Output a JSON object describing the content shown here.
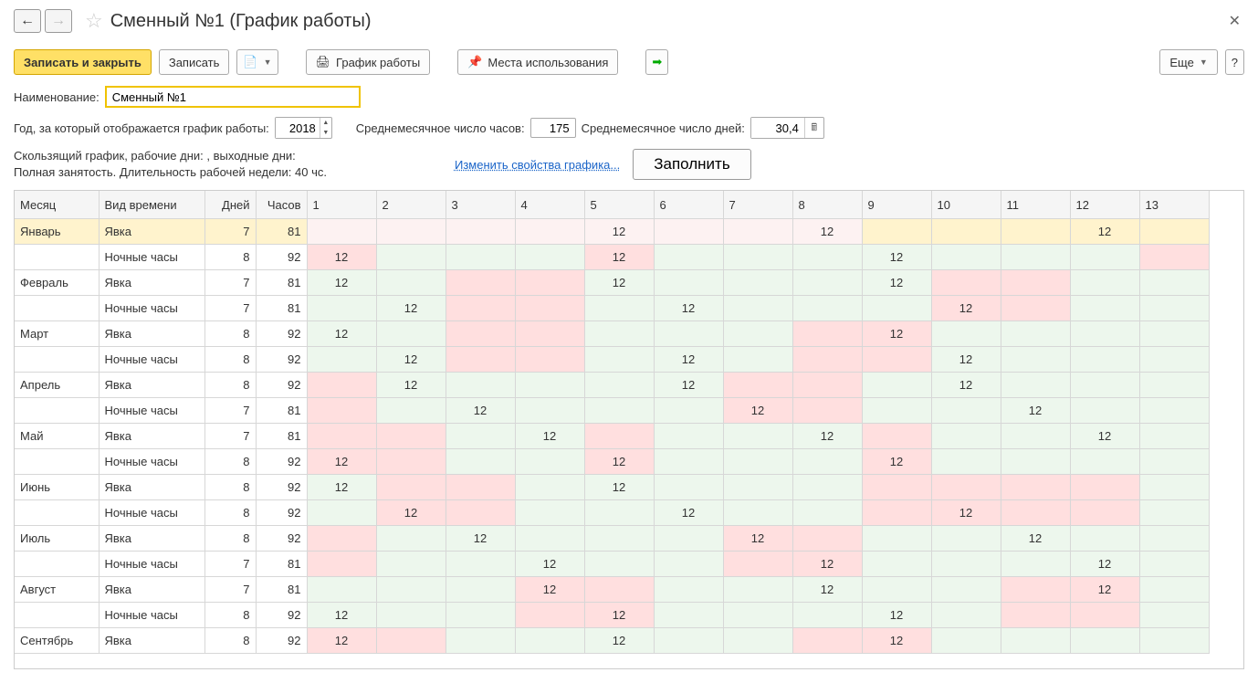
{
  "title": "Сменный №1 (График работы)",
  "toolbar": {
    "save_close": "Записать и закрыть",
    "save": "Записать",
    "print_schedule": "График работы",
    "usage_places": "Места использования",
    "more": "Еще",
    "help": "?"
  },
  "fields": {
    "name_label": "Наименование:",
    "name_value": "Сменный №1",
    "year_label": "Год, за который отображается график работы:",
    "year_value": "2018",
    "avg_hours_label": "Среднемесячное число часов:",
    "avg_hours_value": "175",
    "avg_days_label": "Среднемесячное число дней:",
    "avg_days_value": "30,4"
  },
  "info": {
    "line1": "Скользящий график, рабочие дни: , выходные дни:",
    "line2": "Полная занятость. Длительность рабочей недели: 40 чс.",
    "edit_link": "Изменить свойства графика...",
    "fill_button": "Заполнить"
  },
  "table": {
    "headers": {
      "month": "Месяц",
      "type": "Вид времени",
      "days": "Дней",
      "hours": "Часов"
    },
    "day_count": 13,
    "rows": [
      {
        "month": "Январь",
        "type": "Явка",
        "days": "7",
        "hours": "81",
        "first": true,
        "cells": [
          {
            "c": "blush"
          },
          {
            "c": "blush"
          },
          {
            "c": "blush"
          },
          {
            "c": "blush"
          },
          {
            "c": "blush",
            "v": "12"
          },
          {
            "c": "blush"
          },
          {
            "c": "blush"
          },
          {
            "c": "blush",
            "v": "12"
          },
          {
            "c": "yellow"
          },
          {
            "c": "yellow"
          },
          {
            "c": "yellow"
          },
          {
            "c": "yellow",
            "v": "12"
          },
          {
            "c": "yellow"
          }
        ]
      },
      {
        "month": "",
        "type": "Ночные часы",
        "days": "8",
        "hours": "92",
        "cells": [
          {
            "c": "pink",
            "v": "12"
          },
          {
            "c": "green"
          },
          {
            "c": "green"
          },
          {
            "c": "green"
          },
          {
            "c": "pink",
            "v": "12"
          },
          {
            "c": "green"
          },
          {
            "c": "green"
          },
          {
            "c": "green"
          },
          {
            "c": "green",
            "v": "12"
          },
          {
            "c": "green"
          },
          {
            "c": "green"
          },
          {
            "c": "green"
          },
          {
            "c": "pink"
          }
        ]
      },
      {
        "month": "Февраль",
        "type": "Явка",
        "days": "7",
        "hours": "81",
        "cells": [
          {
            "c": "green",
            "v": "12"
          },
          {
            "c": "green"
          },
          {
            "c": "pink"
          },
          {
            "c": "pink"
          },
          {
            "c": "green",
            "v": "12"
          },
          {
            "c": "green"
          },
          {
            "c": "green"
          },
          {
            "c": "green"
          },
          {
            "c": "green",
            "v": "12"
          },
          {
            "c": "pink"
          },
          {
            "c": "pink"
          },
          {
            "c": "green"
          },
          {
            "c": "green"
          }
        ]
      },
      {
        "month": "",
        "type": "Ночные часы",
        "days": "7",
        "hours": "81",
        "cells": [
          {
            "c": "green"
          },
          {
            "c": "green",
            "v": "12"
          },
          {
            "c": "pink"
          },
          {
            "c": "pink"
          },
          {
            "c": "green"
          },
          {
            "c": "green",
            "v": "12"
          },
          {
            "c": "green"
          },
          {
            "c": "green"
          },
          {
            "c": "green"
          },
          {
            "c": "pink",
            "v": "12"
          },
          {
            "c": "pink"
          },
          {
            "c": "green"
          },
          {
            "c": "green"
          }
        ]
      },
      {
        "month": "Март",
        "type": "Явка",
        "days": "8",
        "hours": "92",
        "cells": [
          {
            "c": "green",
            "v": "12"
          },
          {
            "c": "green"
          },
          {
            "c": "pink"
          },
          {
            "c": "pink"
          },
          {
            "c": "green"
          },
          {
            "c": "green"
          },
          {
            "c": "green"
          },
          {
            "c": "pink"
          },
          {
            "c": "pink",
            "v": "12"
          },
          {
            "c": "green"
          },
          {
            "c": "green"
          },
          {
            "c": "green"
          },
          {
            "c": "green"
          }
        ]
      },
      {
        "month": "",
        "type": "Ночные часы",
        "days": "8",
        "hours": "92",
        "cells": [
          {
            "c": "green"
          },
          {
            "c": "green",
            "v": "12"
          },
          {
            "c": "pink"
          },
          {
            "c": "pink"
          },
          {
            "c": "green"
          },
          {
            "c": "green",
            "v": "12"
          },
          {
            "c": "green"
          },
          {
            "c": "pink"
          },
          {
            "c": "pink"
          },
          {
            "c": "green",
            "v": "12"
          },
          {
            "c": "green"
          },
          {
            "c": "green"
          },
          {
            "c": "green"
          }
        ]
      },
      {
        "month": "Апрель",
        "type": "Явка",
        "days": "8",
        "hours": "92",
        "cells": [
          {
            "c": "pink"
          },
          {
            "c": "green",
            "v": "12"
          },
          {
            "c": "green"
          },
          {
            "c": "green"
          },
          {
            "c": "green"
          },
          {
            "c": "green",
            "v": "12"
          },
          {
            "c": "pink"
          },
          {
            "c": "pink"
          },
          {
            "c": "green"
          },
          {
            "c": "green",
            "v": "12"
          },
          {
            "c": "green"
          },
          {
            "c": "green"
          },
          {
            "c": "green"
          }
        ]
      },
      {
        "month": "",
        "type": "Ночные часы",
        "days": "7",
        "hours": "81",
        "cells": [
          {
            "c": "pink"
          },
          {
            "c": "green"
          },
          {
            "c": "green",
            "v": "12"
          },
          {
            "c": "green"
          },
          {
            "c": "green"
          },
          {
            "c": "green"
          },
          {
            "c": "pink",
            "v": "12"
          },
          {
            "c": "pink"
          },
          {
            "c": "green"
          },
          {
            "c": "green"
          },
          {
            "c": "green",
            "v": "12"
          },
          {
            "c": "green"
          },
          {
            "c": "green"
          }
        ]
      },
      {
        "month": "Май",
        "type": "Явка",
        "days": "7",
        "hours": "81",
        "cells": [
          {
            "c": "pink"
          },
          {
            "c": "pink"
          },
          {
            "c": "green"
          },
          {
            "c": "green",
            "v": "12"
          },
          {
            "c": "pink"
          },
          {
            "c": "green"
          },
          {
            "c": "green"
          },
          {
            "c": "green",
            "v": "12"
          },
          {
            "c": "pink"
          },
          {
            "c": "green"
          },
          {
            "c": "green"
          },
          {
            "c": "green",
            "v": "12"
          },
          {
            "c": "green"
          }
        ]
      },
      {
        "month": "",
        "type": "Ночные часы",
        "days": "8",
        "hours": "92",
        "cells": [
          {
            "c": "pink",
            "v": "12"
          },
          {
            "c": "pink"
          },
          {
            "c": "green"
          },
          {
            "c": "green"
          },
          {
            "c": "pink",
            "v": "12"
          },
          {
            "c": "green"
          },
          {
            "c": "green"
          },
          {
            "c": "green"
          },
          {
            "c": "pink",
            "v": "12"
          },
          {
            "c": "green"
          },
          {
            "c": "green"
          },
          {
            "c": "green"
          },
          {
            "c": "green"
          }
        ]
      },
      {
        "month": "Июнь",
        "type": "Явка",
        "days": "8",
        "hours": "92",
        "cells": [
          {
            "c": "green",
            "v": "12"
          },
          {
            "c": "pink"
          },
          {
            "c": "pink"
          },
          {
            "c": "green"
          },
          {
            "c": "green",
            "v": "12"
          },
          {
            "c": "green"
          },
          {
            "c": "green"
          },
          {
            "c": "green"
          },
          {
            "c": "pink"
          },
          {
            "c": "pink"
          },
          {
            "c": "pink"
          },
          {
            "c": "pink"
          },
          {
            "c": "green"
          }
        ]
      },
      {
        "month": "",
        "type": "Ночные часы",
        "days": "8",
        "hours": "92",
        "cells": [
          {
            "c": "green"
          },
          {
            "c": "pink",
            "v": "12"
          },
          {
            "c": "pink"
          },
          {
            "c": "green"
          },
          {
            "c": "green"
          },
          {
            "c": "green",
            "v": "12"
          },
          {
            "c": "green"
          },
          {
            "c": "green"
          },
          {
            "c": "pink"
          },
          {
            "c": "pink",
            "v": "12"
          },
          {
            "c": "pink"
          },
          {
            "c": "pink"
          },
          {
            "c": "green"
          }
        ]
      },
      {
        "month": "Июль",
        "type": "Явка",
        "days": "8",
        "hours": "92",
        "cells": [
          {
            "c": "pink"
          },
          {
            "c": "green"
          },
          {
            "c": "green",
            "v": "12"
          },
          {
            "c": "green"
          },
          {
            "c": "green"
          },
          {
            "c": "green"
          },
          {
            "c": "pink",
            "v": "12"
          },
          {
            "c": "pink"
          },
          {
            "c": "green"
          },
          {
            "c": "green"
          },
          {
            "c": "green",
            "v": "12"
          },
          {
            "c": "green"
          },
          {
            "c": "green"
          }
        ]
      },
      {
        "month": "",
        "type": "Ночные часы",
        "days": "7",
        "hours": "81",
        "cells": [
          {
            "c": "pink"
          },
          {
            "c": "green"
          },
          {
            "c": "green"
          },
          {
            "c": "green",
            "v": "12"
          },
          {
            "c": "green"
          },
          {
            "c": "green"
          },
          {
            "c": "pink"
          },
          {
            "c": "pink",
            "v": "12"
          },
          {
            "c": "green"
          },
          {
            "c": "green"
          },
          {
            "c": "green"
          },
          {
            "c": "green",
            "v": "12"
          },
          {
            "c": "green"
          }
        ]
      },
      {
        "month": "Август",
        "type": "Явка",
        "days": "7",
        "hours": "81",
        "cells": [
          {
            "c": "green"
          },
          {
            "c": "green"
          },
          {
            "c": "green"
          },
          {
            "c": "pink",
            "v": "12"
          },
          {
            "c": "pink"
          },
          {
            "c": "green"
          },
          {
            "c": "green"
          },
          {
            "c": "green",
            "v": "12"
          },
          {
            "c": "green"
          },
          {
            "c": "green"
          },
          {
            "c": "pink"
          },
          {
            "c": "pink",
            "v": "12"
          },
          {
            "c": "green"
          }
        ]
      },
      {
        "month": "",
        "type": "Ночные часы",
        "days": "8",
        "hours": "92",
        "cells": [
          {
            "c": "green",
            "v": "12"
          },
          {
            "c": "green"
          },
          {
            "c": "green"
          },
          {
            "c": "pink"
          },
          {
            "c": "pink",
            "v": "12"
          },
          {
            "c": "green"
          },
          {
            "c": "green"
          },
          {
            "c": "green"
          },
          {
            "c": "green",
            "v": "12"
          },
          {
            "c": "green"
          },
          {
            "c": "pink"
          },
          {
            "c": "pink"
          },
          {
            "c": "green"
          }
        ]
      },
      {
        "month": "Сентябрь",
        "type": "Явка",
        "days": "8",
        "hours": "92",
        "cells": [
          {
            "c": "pink",
            "v": "12"
          },
          {
            "c": "pink"
          },
          {
            "c": "green"
          },
          {
            "c": "green"
          },
          {
            "c": "green",
            "v": "12"
          },
          {
            "c": "green"
          },
          {
            "c": "green"
          },
          {
            "c": "pink"
          },
          {
            "c": "pink",
            "v": "12"
          },
          {
            "c": "green"
          },
          {
            "c": "green"
          },
          {
            "c": "green"
          },
          {
            "c": "green"
          }
        ]
      }
    ]
  }
}
